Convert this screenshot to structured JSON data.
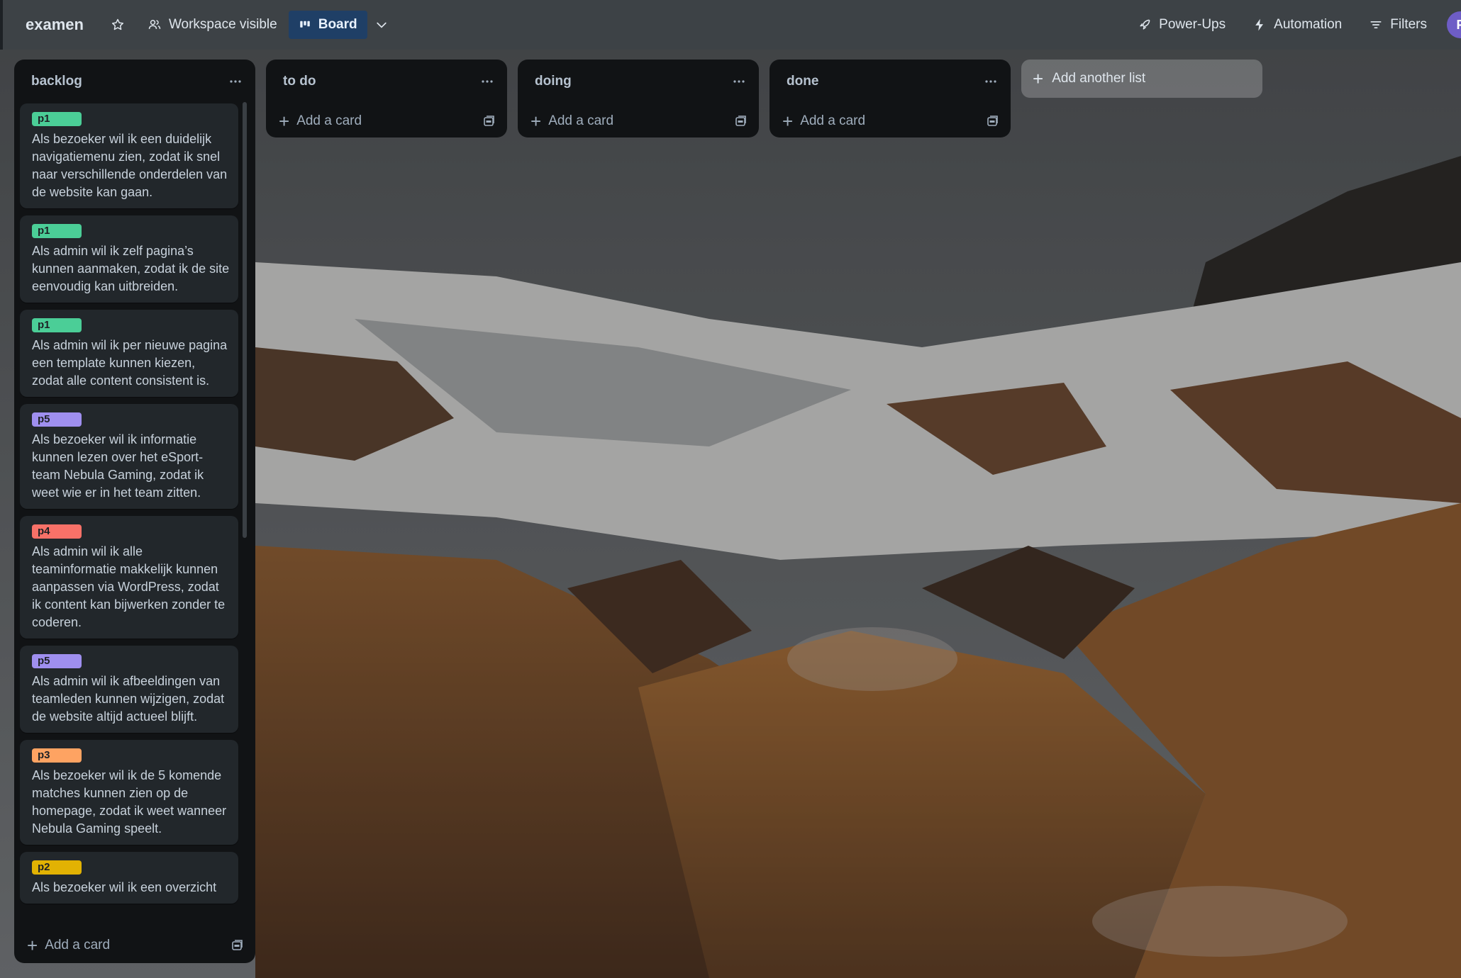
{
  "header": {
    "board_title": "examen",
    "visibility_label": "Workspace visible",
    "view_label": "Board",
    "powerups_label": "Power-Ups",
    "automation_label": "Automation",
    "filters_label": "Filters",
    "avatar_initial": "F"
  },
  "lists": {
    "backlog": {
      "title": "backlog",
      "add_card_label": "Add a card",
      "cards": [
        {
          "label": "p1",
          "label_color": "#4bce97",
          "text": "Als bezoeker wil ik een duidelijk navigatiemenu zien, zodat ik snel naar verschillende onderdelen van de website kan gaan."
        },
        {
          "label": "p1",
          "label_color": "#4bce97",
          "text": "Als admin wil ik zelf pagina’s kunnen aanmaken, zodat ik de site eenvoudig kan uitbreiden."
        },
        {
          "label": "p1",
          "label_color": "#4bce97",
          "text": "Als admin wil ik per nieuwe pagina een template kunnen kiezen, zodat alle content consistent is."
        },
        {
          "label": "p5",
          "label_color": "#9f8fef",
          "text": "Als bezoeker wil ik informatie kunnen lezen over het eSport-team Nebula Gaming, zodat ik weet wie er in het team zitten."
        },
        {
          "label": "p4",
          "label_color": "#f87168",
          "text": "Als admin wil ik alle teaminformatie makkelijk kunnen aanpassen via WordPress, zodat ik content kan bijwerken zonder te coderen."
        },
        {
          "label": "p5",
          "label_color": "#9f8fef",
          "text": "Als admin wil ik afbeeldingen van teamleden kunnen wijzigen, zodat de website altijd actueel blijft."
        },
        {
          "label": "p3",
          "label_color": "#fea362",
          "text": "Als bezoeker wil ik de 5 komende matches kunnen zien op de homepage, zodat ik weet wanneer Nebula Gaming speelt."
        },
        {
          "label": "p2",
          "label_color": "#e2b203",
          "text": "Als bezoeker wil ik een overzicht"
        }
      ]
    },
    "todo": {
      "title": "to do",
      "add_card_label": "Add a card"
    },
    "doing": {
      "title": "doing",
      "add_card_label": "Add a card"
    },
    "done": {
      "title": "done",
      "add_card_label": "Add a card"
    }
  },
  "add_list_label": "Add another list"
}
